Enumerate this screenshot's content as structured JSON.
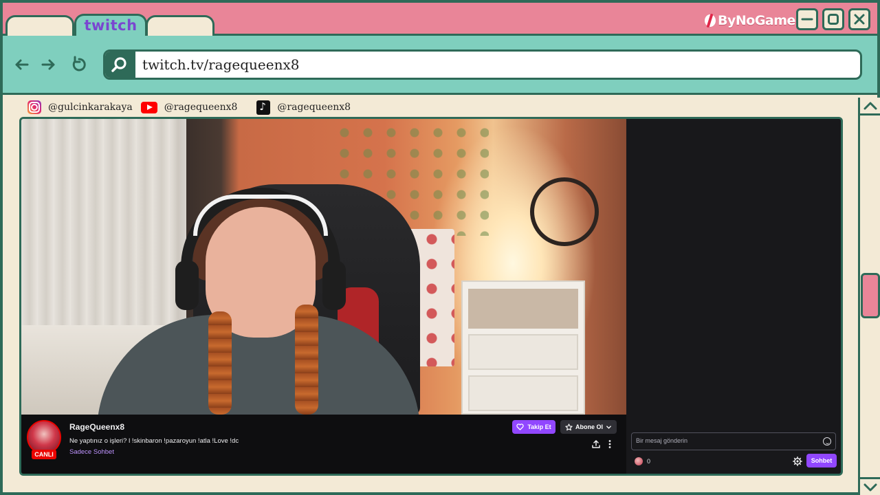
{
  "browser": {
    "active_tab_label": "twitch",
    "brand": "ByNoGame",
    "url": "twitch.tv/ragequeenx8",
    "colors": {
      "frame_border": "#2e6a58",
      "titlebar": "#e98598",
      "addressbar": "#7fcfbe",
      "page_bg": "#f3ead6",
      "twitch_purple": "#9147ff"
    },
    "icons": [
      "back-arrow-icon",
      "forward-arrow-icon",
      "reload-icon",
      "search-icon",
      "minimize-icon",
      "maximize-icon",
      "close-icon"
    ]
  },
  "socials": [
    {
      "icon": "instagram-icon",
      "handle": "@gulcinkarakaya"
    },
    {
      "icon": "youtube-icon",
      "handle": "@ragequeenx8"
    },
    {
      "icon": "tiktok-icon",
      "handle": "@ragequeenx8"
    }
  ],
  "stream": {
    "channel_name": "RageQueenx8",
    "live_badge": "CANLI",
    "title": "Ne yaptınız o işleri? l !skinbaron !pazaroyun !atla !Love !dc",
    "category": "Sadece Sohbet",
    "follow_label": "Takip Et",
    "subscribe_label": "Abone Ol"
  },
  "chat": {
    "placeholder": "Bir mesaj gönderin",
    "points": "0",
    "send_label": "Sohbet"
  }
}
